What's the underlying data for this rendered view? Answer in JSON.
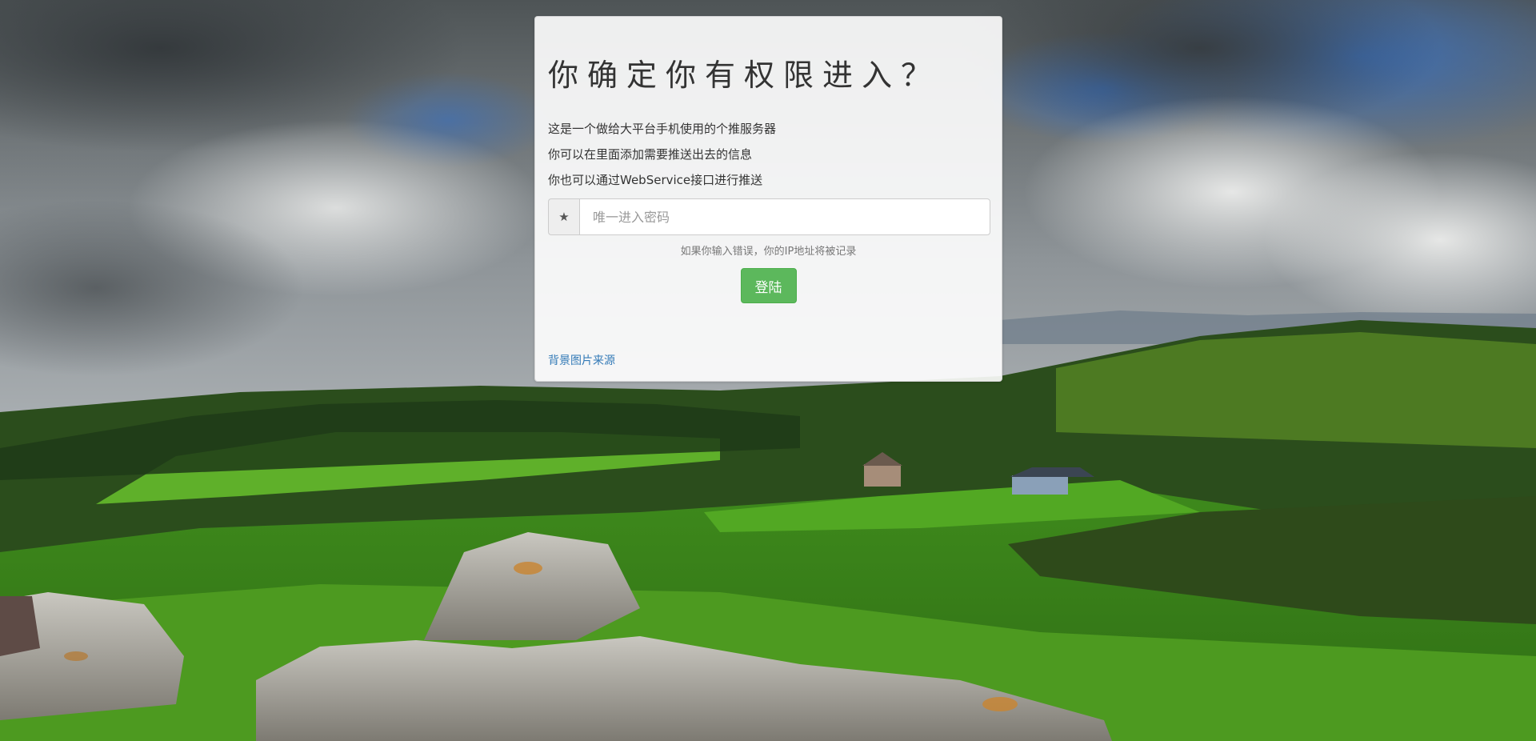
{
  "page": {
    "title": "你确定你有权限进入？",
    "description_lines": [
      "这是一个做给大平台手机使用的个推服务器",
      "你可以在里面添加需要推送出去的信息",
      "你也可以通过WebService接口进行推送"
    ]
  },
  "form": {
    "addon_icon": "star-icon",
    "addon_glyph": "★",
    "password_placeholder": "唯一进入密码",
    "password_value": "",
    "warning": "如果你输入错误，你的IP地址将被记录",
    "login_label": "登陆"
  },
  "footer": {
    "source_link": "背景图片来源"
  },
  "colors": {
    "login_button": "#5cb85c",
    "link": "#337ab7",
    "card_background": "rgba(255,255,255,0.90)"
  }
}
